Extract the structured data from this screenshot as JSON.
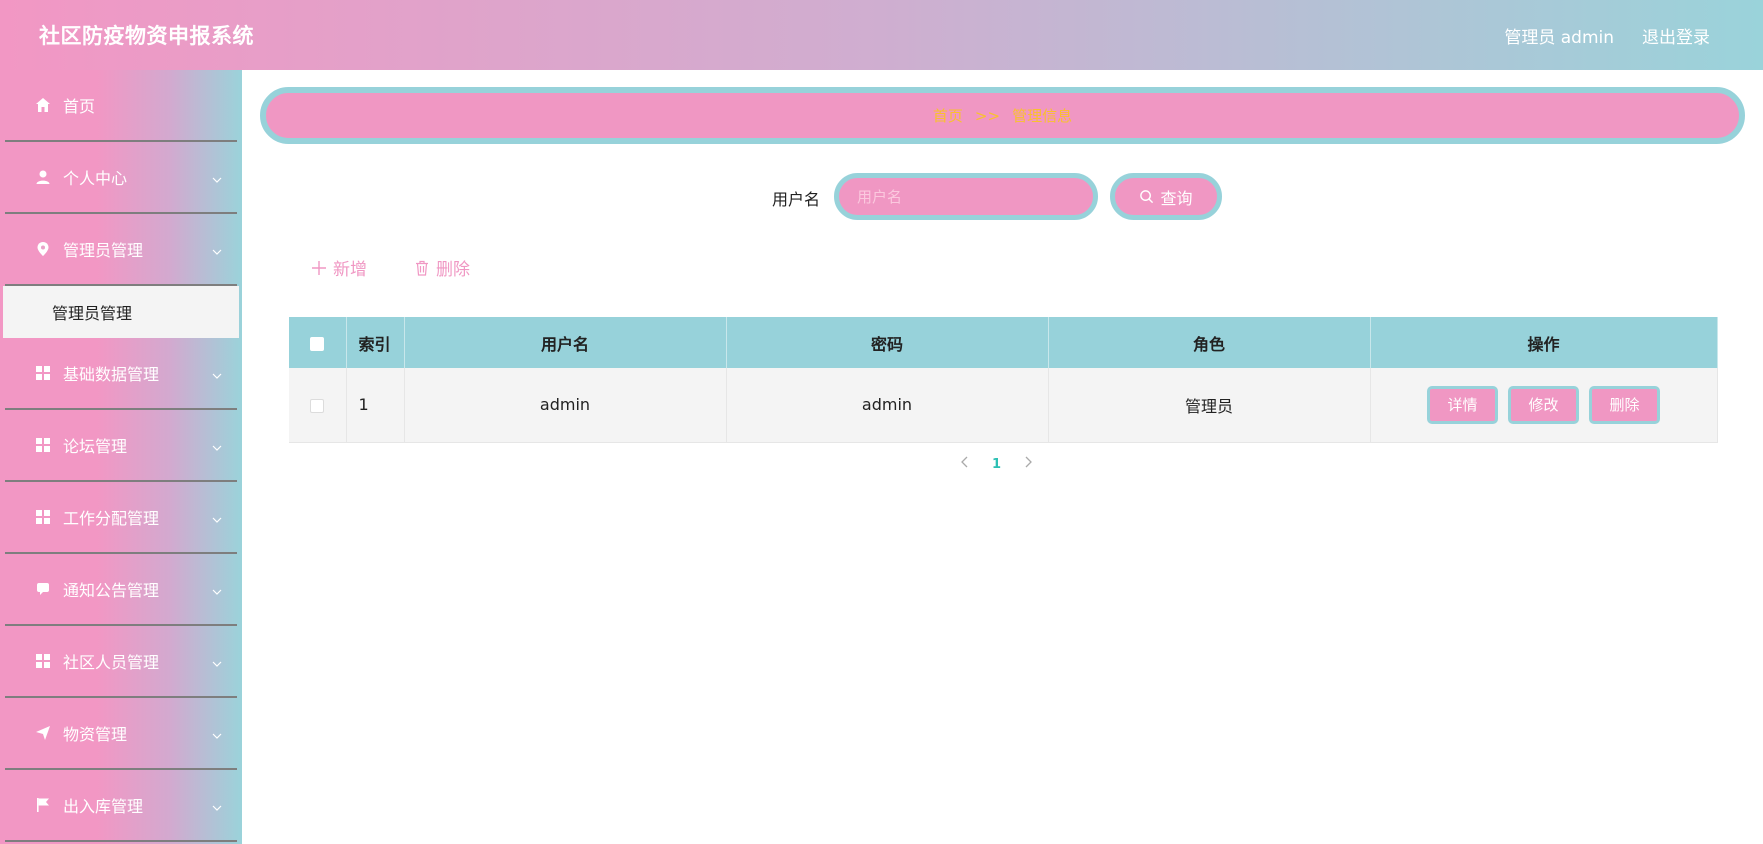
{
  "header": {
    "title": "社区防疫物资申报系统",
    "user_label": "管理员 admin",
    "logout_label": "退出登录"
  },
  "sidebar": {
    "items": [
      {
        "label": "首页",
        "icon": "home-icon"
      },
      {
        "label": "个人中心",
        "icon": "user-icon"
      },
      {
        "label": "管理员管理",
        "icon": "location-pin-icon"
      },
      {
        "label": "基础数据管理",
        "icon": "grid-icon"
      },
      {
        "label": "论坛管理",
        "icon": "grid-icon"
      },
      {
        "label": "工作分配管理",
        "icon": "grid-icon"
      },
      {
        "label": "通知公告管理",
        "icon": "chat-icon"
      },
      {
        "label": "社区人员管理",
        "icon": "grid-icon"
      },
      {
        "label": "物资管理",
        "icon": "send-icon"
      },
      {
        "label": "出入库管理",
        "icon": "flag-icon"
      }
    ],
    "active_submenu": "管理员管理"
  },
  "breadcrumb": {
    "home": "首页",
    "separator": ">>",
    "current": "管理信息"
  },
  "search": {
    "label": "用户名",
    "placeholder": "用户名",
    "value": "",
    "button_label": "查询"
  },
  "actions": {
    "add_label": "新增",
    "delete_label": "删除"
  },
  "table": {
    "headers": [
      "索引",
      "用户名",
      "密码",
      "角色",
      "操作"
    ],
    "rows": [
      {
        "index": "1",
        "username": "admin",
        "password": "admin",
        "role": "管理员"
      }
    ],
    "row_actions": [
      "详情",
      "修改",
      "删除"
    ]
  },
  "pagination": {
    "current_page": "1"
  },
  "colors": {
    "pink": "#f097c3",
    "teal": "#97d2da",
    "breadcrumb_text": "#f9c12e",
    "page_active": "#2cc0b4"
  }
}
